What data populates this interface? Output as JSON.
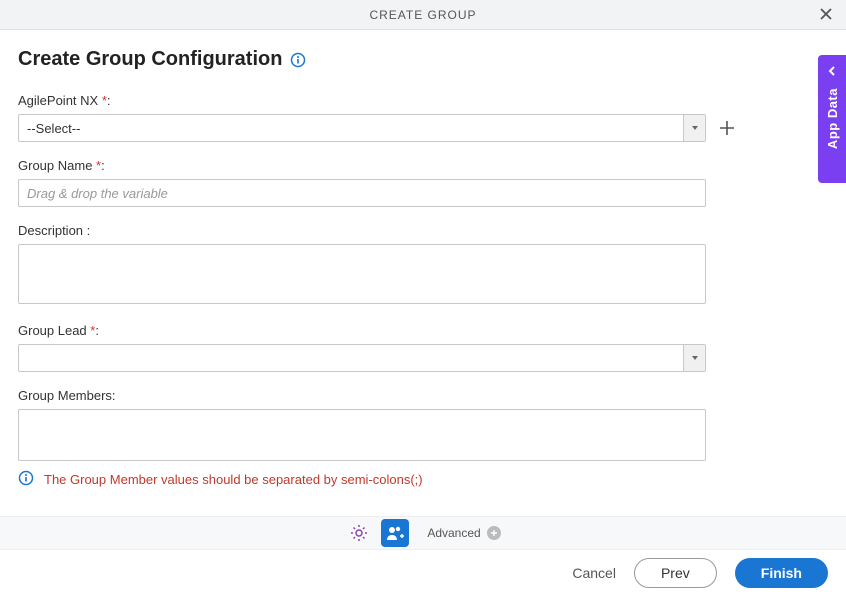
{
  "header": {
    "title": "CREATE GROUP"
  },
  "page_title": "Create Group Configuration",
  "fields": {
    "agilepoint": {
      "label": "AgilePoint NX ",
      "req": "*",
      "colon": ":",
      "selected": "--Select--"
    },
    "group_name": {
      "label": "Group Name ",
      "req": "*",
      "colon": ":",
      "placeholder": "Drag & drop the variable"
    },
    "description": {
      "label": "Description :"
    },
    "group_lead": {
      "label": "Group Lead ",
      "req": "*",
      "colon": ":"
    },
    "group_members": {
      "label": "Group Members:"
    }
  },
  "hint": "The Group Member values should be separated by semi-colons(;)",
  "side_tab": {
    "label": "App Data"
  },
  "toolbar": {
    "advanced": "Advanced"
  },
  "footer": {
    "cancel": "Cancel",
    "prev": "Prev",
    "finish": "Finish"
  }
}
